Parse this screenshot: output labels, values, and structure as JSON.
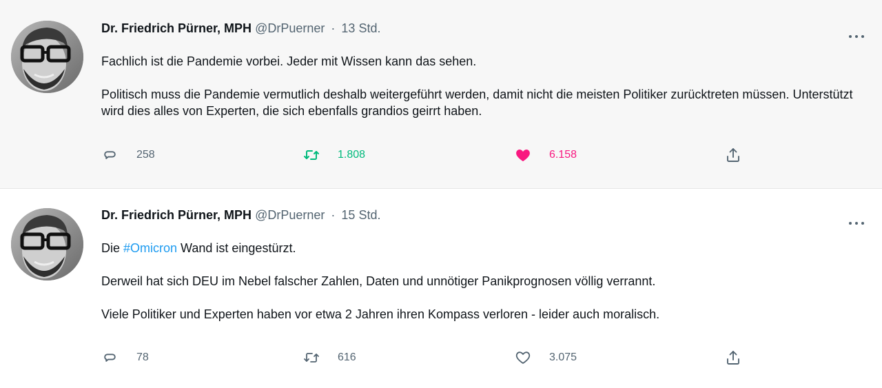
{
  "tweets": [
    {
      "author": {
        "name": "Dr. Friedrich Pürner, MPH",
        "handle": "@DrPuerner",
        "time": "13 Std."
      },
      "paragraphs": [
        "Fachlich ist die Pandemie vorbei. Jeder mit Wissen kann das sehen.",
        "Politisch muss die Pandemie vermutlich deshalb weitergeführt werden, damit nicht die meisten Politiker zurücktreten müssen. Unterstützt wird dies alles von Experten, die sich ebenfalls grandios geirrt haben."
      ],
      "replies": "258",
      "retweets": "1.808",
      "likes": "6.158",
      "retweeted": true,
      "liked": true
    },
    {
      "author": {
        "name": "Dr. Friedrich Pürner, MPH",
        "handle": "@DrPuerner",
        "time": "15 Std."
      },
      "first_prefix": "Die ",
      "hashtag": "#Omicron",
      "first_suffix": " Wand ist eingestürzt.",
      "paragraphs": [
        "Derweil hat sich DEU im Nebel falscher Zahlen, Daten und unnötiger Panikprognosen völlig verrannt.",
        "Viele Politiker und Experten haben vor etwa 2 Jahren ihren Kompass verloren - leider auch moralisch."
      ],
      "replies": "78",
      "retweets": "616",
      "likes": "3.075",
      "retweeted": false,
      "liked": false
    }
  ],
  "icons": {
    "reply": "reply-icon",
    "retweet": "retweet-icon",
    "like": "heart-icon",
    "share": "share-icon",
    "more": "more-icon"
  },
  "colors": {
    "retweet_active": "#00ba7c",
    "like_active": "#f91880",
    "hashtag": "#1d9bf0",
    "muted": "#536471"
  }
}
